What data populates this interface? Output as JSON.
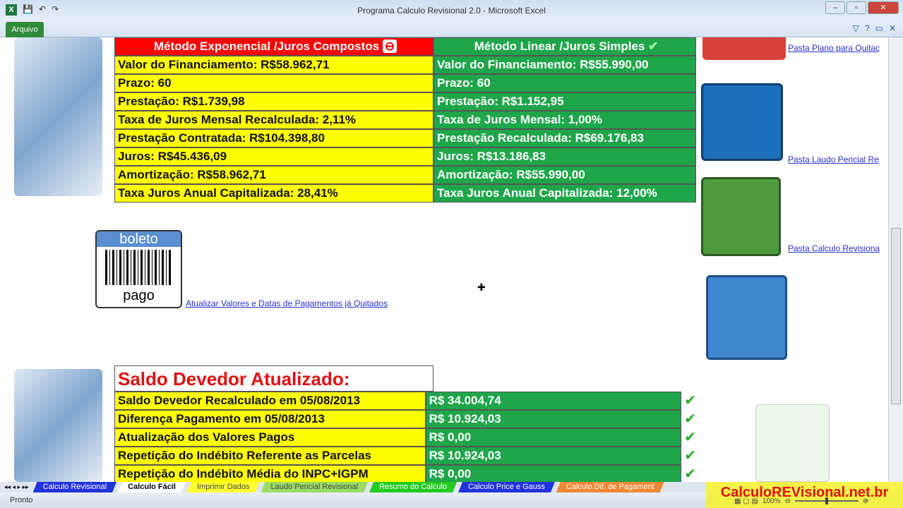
{
  "window": {
    "title": "Programa Calculo Revisional 2.0  -  Microsoft Excel",
    "file_tab": "Arquivo"
  },
  "exp": {
    "header": "Método Exponencial /Juros Compostos",
    "rows": [
      "Valor do Financiamento: R$58.962,71",
      "Prazo: 60",
      "Prestação: R$1.739,98",
      "Taxa de Juros Mensal Recalculada:  2,11%",
      "Prestação Contratada: R$104.398,80",
      "Juros: R$45.436,09",
      "Amortização: R$58.962,71",
      "Taxa Juros Anual Capitalizada: 28,41%"
    ]
  },
  "lin": {
    "header": "Método Linear /Juros Simples",
    "rows": [
      "Valor do Financiamento: R$55.990,00",
      "Prazo: 60",
      "Prestação: R$1.152,95",
      "Taxa de Juros Mensal:  1,00%",
      "Prestação Recalculada: R$69.176,83",
      "Juros: R$13.186,83",
      "Amortização: R$55.990,00",
      "Taxa Juros Anual Capitalizada: 12,00%"
    ]
  },
  "boleto": {
    "top": "boleto",
    "bottom": "pago",
    "link": "Atualizar Valores e Datas de Pagamentos já Quitados"
  },
  "links": [
    "Pasta Plano para Quitaç",
    "Pasta Laudo Pericial Re",
    "Pasta Calculo Revisiona"
  ],
  "saldo": {
    "title": "Saldo Devedor Atualizado:",
    "rows": [
      {
        "label": "Saldo Devedor Recalculado em 05/08/2013",
        "value": "R$ 34.004,74"
      },
      {
        "label": "Diferença Pagamento em 05/08/2013",
        "value": "R$ 10.924,03"
      },
      {
        "label": "Atualização dos Valores Pagos",
        "value": "R$ 0,00"
      },
      {
        "label": "Repetição do Indébito Referente as Parcelas",
        "value": "R$ 10.924,03"
      },
      {
        "label": "Repetição do Indébito Média do INPC+IGPM",
        "value": "R$ 0,00"
      }
    ]
  },
  "tabs": [
    {
      "label": "Calculo Revisional",
      "color": "#2233dd"
    },
    {
      "label": "Calculo Fácil",
      "color": "#ffffff"
    },
    {
      "label": "Imprimir Dados",
      "color": "#ffff33"
    },
    {
      "label": "Laudo Pericial Revisional",
      "color": "#99dd66"
    },
    {
      "label": "Resumo do Calculo",
      "color": "#22cc22"
    },
    {
      "label": "Calculo Price e Gauss",
      "color": "#2233dd"
    },
    {
      "label": "Calculo.Dif. de Pagament",
      "color": "#ee8833"
    }
  ],
  "status": {
    "ready": "Pronto",
    "zoom": "100%"
  },
  "brand": "CalculoREVisional.net.br"
}
